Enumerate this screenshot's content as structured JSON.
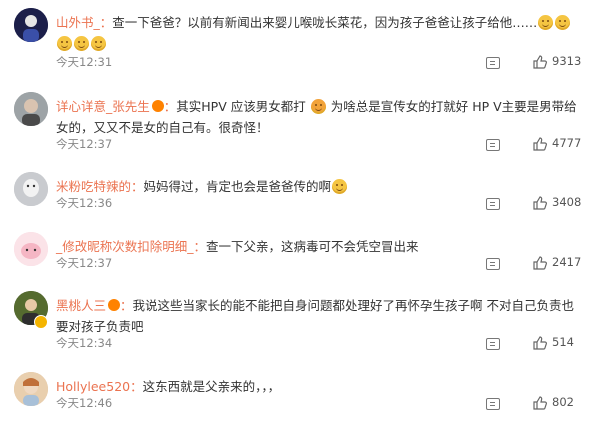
{
  "comments": [
    {
      "author": "山外书_",
      "text": "查一下爸爸？以前有新闻出来婴儿喉咙长菜花，因为孩子爸爸让孩子给他……",
      "time": "今天12:31",
      "likes": "9313",
      "icons": [
        "reply-icon",
        "like-icon",
        "grin-emoji-icon"
      ]
    },
    {
      "author": "详心详意_张先生",
      "text_a": "其实HPV 应该男女都打",
      "text_b": "为啥总是宣传女的打就好 HP V主要是男带给女的，又又不是女的自己有。很奇怪！",
      "time": "今天12:37",
      "likes": "4777",
      "icons": [
        "vip-badge-icon",
        "frown-emoji-icon"
      ]
    },
    {
      "author": "米粉吃特辣的",
      "text": "妈妈得过，肯定也会是爸爸传的啊",
      "time": "今天12:36",
      "likes": "3408",
      "icons": [
        "smile-emoji-icon"
      ]
    },
    {
      "author": "_修改昵称次数扣除明细_",
      "text": "查一下父亲，这病毒可不会凭空冒出来",
      "time": "今天12:37",
      "likes": "2417"
    },
    {
      "author": "黑桃人三",
      "text": "我说这些当家长的能不能把自身问题都处理好了再怀孕生孩子啊 不对自己负责也要对孩子负责吧",
      "time": "今天12:34",
      "likes": "514",
      "icons": [
        "vip-badge-icon"
      ]
    },
    {
      "author": "Hollylee520",
      "text": "这东西就是父亲来的，，，",
      "time": "今天12:46",
      "likes": "802"
    }
  ],
  "separator": "："
}
